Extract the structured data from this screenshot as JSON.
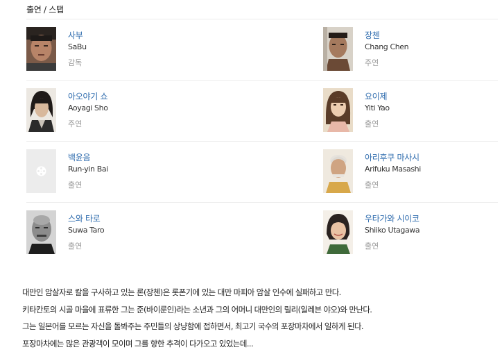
{
  "section": {
    "title": "출연 / 스탭"
  },
  "cast": [
    {
      "name_ko": "사부",
      "name_en": "SaBu",
      "role": "감독",
      "photo": "portrait-sabu"
    },
    {
      "name_ko": "장첸",
      "name_en": "Chang Chen",
      "role": "주연",
      "photo": "portrait-chang-chen"
    },
    {
      "name_ko": "아오야기 쇼",
      "name_en": "Aoyagi Sho",
      "role": "주연",
      "photo": "portrait-aoyagi-sho"
    },
    {
      "name_ko": "요이제",
      "name_en": "Yiti Yao",
      "role": "출연",
      "photo": "portrait-yiti-yao"
    },
    {
      "name_ko": "백윤음",
      "name_en": "Run-yin Bai",
      "role": "출연",
      "photo": "film-reel-placeholder-icon"
    },
    {
      "name_ko": "아리후쿠 마사시",
      "name_en": "Arifuku Masashi",
      "role": "출연",
      "photo": "portrait-arifuku-masashi"
    },
    {
      "name_ko": "스와 타로",
      "name_en": "Suwa Taro",
      "role": "출연",
      "photo": "portrait-suwa-taro"
    },
    {
      "name_ko": "우타가와 시이코",
      "name_en": "Shiiko Utagawa",
      "role": "출연",
      "photo": "portrait-shiiko-utagawa"
    }
  ],
  "synopsis": {
    "lines": [
      "대만인 암살자로 칼을 구사하고 있는 론(장첸)은 롯폰기에 있는 대만 마피아 암살 인수에 실패하고 만다.",
      "키타칸토의 시골 마을에 표류한 그는 준(바이룬인)라는 소년과 그의 어머니 대만인의 릴리(일레븐 야오)와 만난다.",
      "그는 일본어를 모르는 자신을 돌봐주는 주민들의 상냥함에 접하면서, 최고기 국수의 포장마차에서 일하게 된다.",
      "포장마차에는 많은 관광객이 모이며 그를 향한 추격이 다가오고 있었는데..."
    ]
  },
  "colors": {
    "link": "#2f6cae",
    "role": "#9a9a9a",
    "divider": "#ececec",
    "text": "#222222"
  }
}
